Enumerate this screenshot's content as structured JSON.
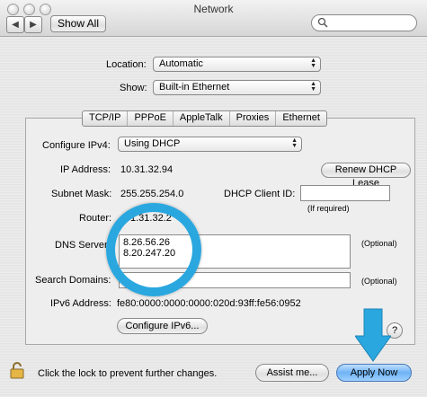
{
  "window": {
    "title": "Network"
  },
  "toolbar": {
    "back": "◀",
    "forward": "▶",
    "show_all_label": "Show All",
    "search_placeholder": ""
  },
  "location": {
    "label": "Location:",
    "value": "Automatic"
  },
  "show": {
    "label": "Show:",
    "value": "Built-in Ethernet"
  },
  "tabs": [
    "TCP/IP",
    "PPPoE",
    "AppleTalk",
    "Proxies",
    "Ethernet"
  ],
  "tcpip": {
    "configure_label": "Configure IPv4:",
    "configure_value": "Using DHCP",
    "ip_label": "IP Address:",
    "ip_value": "10.31.32.94",
    "renew_label": "Renew DHCP Lease",
    "subnet_label": "Subnet Mask:",
    "subnet_value": "255.255.254.0",
    "dhcp_client_label": "DHCP Client ID:",
    "dhcp_client_value": "",
    "if_required": "(If required)",
    "router_label": "Router:",
    "router_value": "1.31.32.2",
    "dns_label": "DNS Server",
    "dns_servers": [
      "8.26.56.26",
      "8.20.247.20"
    ],
    "optional_1": "(Optional)",
    "search_label": "Search Domains:",
    "search_value": "",
    "optional_2": "(Optional)",
    "ipv6_label": "IPv6 Address:",
    "ipv6_value": "fe80:0000:0000:0000:020d:93ff:fe56:0952",
    "configure_ipv6_label": "Configure IPv6...",
    "help": "?"
  },
  "footer": {
    "lock_text": "Click the lock to prevent further changes.",
    "assist_label": "Assist me...",
    "apply_label": "Apply Now"
  },
  "colors": {
    "highlight": "#2aa7df",
    "default_button": "#6fb3f5"
  }
}
